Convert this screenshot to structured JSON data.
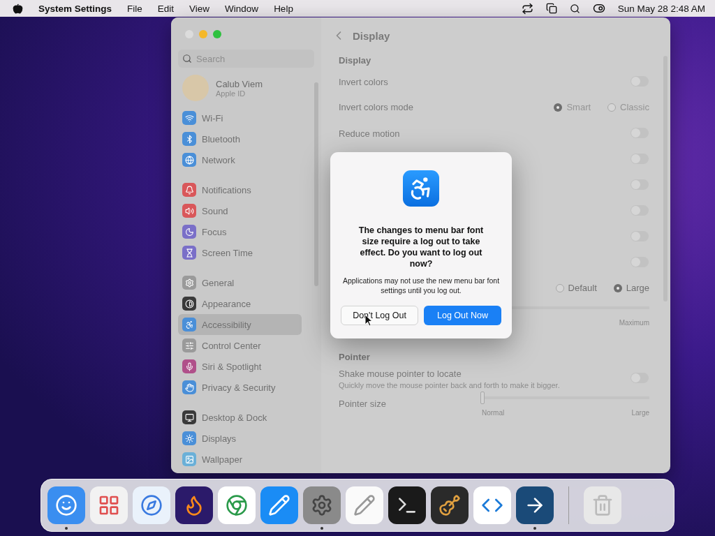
{
  "menubar": {
    "app_name": "System Settings",
    "menus": [
      "File",
      "Edit",
      "View",
      "Window",
      "Help"
    ],
    "clock": "Sun May 28  2:48 AM"
  },
  "window": {
    "title": "Display",
    "search": {
      "placeholder": "Search"
    },
    "account": {
      "name": "Calub Viem",
      "subtitle": "Apple ID"
    },
    "sidebar_groups": [
      [
        {
          "label": "Wi-Fi",
          "selected": false,
          "color": "#4a8fd8"
        },
        {
          "label": "Bluetooth",
          "selected": false,
          "color": "#4a8fd8"
        },
        {
          "label": "Network",
          "selected": false,
          "color": "#4a8fd8"
        }
      ],
      [
        {
          "label": "Notifications",
          "selected": false,
          "color": "#d9575a"
        },
        {
          "label": "Sound",
          "selected": false,
          "color": "#d9575a"
        },
        {
          "label": "Focus",
          "selected": false,
          "color": "#7a6fc8"
        },
        {
          "label": "Screen Time",
          "selected": false,
          "color": "#7a6fc8"
        }
      ],
      [
        {
          "label": "General",
          "selected": false,
          "color": "#9a9a9a"
        },
        {
          "label": "Appearance",
          "selected": false,
          "color": "#3a3a3a"
        },
        {
          "label": "Accessibility",
          "selected": true,
          "color": "#4a8fd8"
        },
        {
          "label": "Control Center",
          "selected": false,
          "color": "#9a9a9a"
        },
        {
          "label": "Siri & Spotlight",
          "selected": false,
          "color": "#b0508a"
        },
        {
          "label": "Privacy & Security",
          "selected": false,
          "color": "#4a8fd8"
        }
      ],
      [
        {
          "label": "Desktop & Dock",
          "selected": false,
          "color": "#3a3a3a"
        },
        {
          "label": "Displays",
          "selected": false,
          "color": "#4a8fd8"
        },
        {
          "label": "Wallpaper",
          "selected": false,
          "color": "#6ab0d8"
        }
      ]
    ],
    "sections": [
      {
        "heading": "Display",
        "rows": [
          {
            "kind": "toggle",
            "label": "Invert colors",
            "on": false
          },
          {
            "kind": "radio",
            "label": "Invert colors mode",
            "disabled": true,
            "options": [
              {
                "label": "Smart",
                "selected": true
              },
              {
                "label": "Classic",
                "selected": false
              }
            ]
          },
          {
            "kind": "toggle",
            "label": "Reduce motion",
            "on": false
          },
          {
            "kind": "toggle",
            "on": false
          },
          {
            "kind": "toggle",
            "on": false
          },
          {
            "kind": "toggle",
            "on": false
          },
          {
            "kind": "toggle",
            "on": false
          },
          {
            "kind": "toggle",
            "on": false
          },
          {
            "kind": "radio",
            "disabled": false,
            "options": [
              {
                "label": "Default",
                "selected": false
              },
              {
                "label": "Large",
                "selected": true
              }
            ]
          },
          {
            "kind": "slider",
            "max_label": "Maximum"
          }
        ]
      },
      {
        "heading": "Pointer",
        "rows": [
          {
            "kind": "toggle",
            "label": "Shake mouse pointer to locate",
            "sublabel": "Quickly move the mouse pointer back and forth to make it bigger.",
            "on": false
          },
          {
            "kind": "slider",
            "label": "Pointer size",
            "level": 0,
            "min_label": "Normal",
            "max_label": "Large"
          }
        ]
      }
    ]
  },
  "dialog": {
    "title": "The changes to menu bar font size require a log out to take effect. Do you want to log out now?",
    "message": "Applications may not use the new menu bar font settings until you log out.",
    "buttons": [
      {
        "label": "Don't Log Out",
        "kind": "secondary"
      },
      {
        "label": "Log Out Now",
        "kind": "primary"
      }
    ]
  },
  "dock": {
    "apps": [
      {
        "running": true
      },
      {
        "running": false
      },
      {
        "running": false
      },
      {
        "running": false
      },
      {
        "running": false
      },
      {
        "running": false
      },
      {
        "running": true
      },
      {
        "running": false
      },
      {
        "running": false
      },
      {
        "running": false
      },
      {
        "running": false
      },
      {
        "running": true
      },
      {
        "running": false
      }
    ]
  }
}
